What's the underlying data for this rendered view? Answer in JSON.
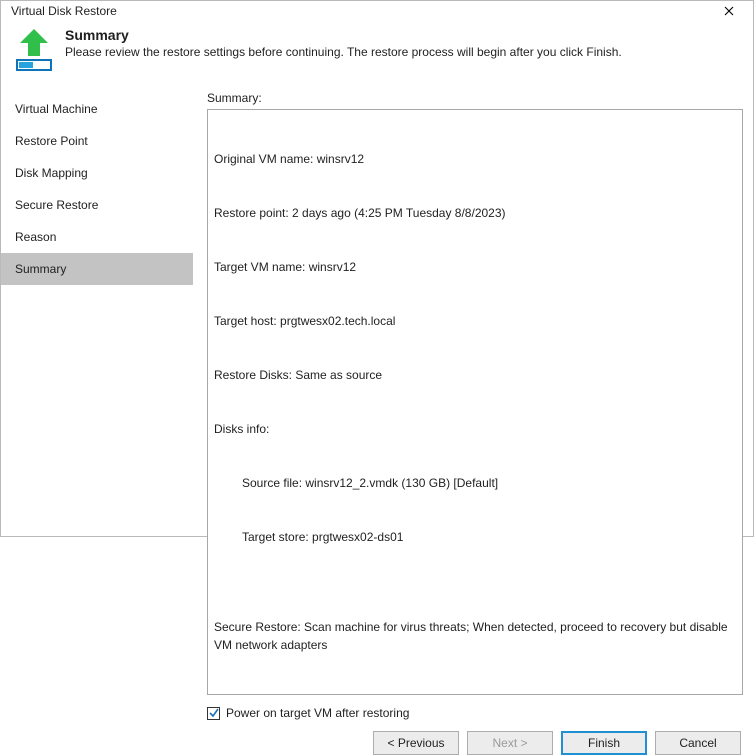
{
  "window": {
    "title": "Virtual Disk Restore"
  },
  "header": {
    "title": "Summary",
    "subtitle": "Please review the restore settings before continuing. The restore process will begin after you click Finish."
  },
  "sidebar": {
    "items": [
      {
        "label": "Virtual Machine"
      },
      {
        "label": "Restore Point"
      },
      {
        "label": "Disk Mapping"
      },
      {
        "label": "Secure Restore"
      },
      {
        "label": "Reason"
      },
      {
        "label": "Summary"
      }
    ],
    "selected_index": 5
  },
  "main": {
    "summary_label": "Summary:",
    "lines": {
      "l1": "Original VM name: winsrv12",
      "l2": "Restore point: 2 days ago (4:25 PM Tuesday 8/8/2023)",
      "l3": "Target VM name: winsrv12",
      "l4": "Target host: prgtwesx02.tech.local",
      "l5": "Restore Disks: Same as source",
      "l6": "Disks info:",
      "l7": "Source file: winsrv12_2.vmdk (130 GB) [Default]",
      "l8": "Target store: prgtwesx02-ds01",
      "l9": "",
      "l10": "Secure Restore: Scan machine for virus threats; When detected, proceed to recovery but disable VM network adapters"
    },
    "checkbox_label": "Power on target VM after restoring",
    "checkbox_checked": true
  },
  "footer": {
    "previous": "< Previous",
    "next": "Next >",
    "finish": "Finish",
    "cancel": "Cancel"
  },
  "colors": {
    "accent": "#1f91d2",
    "nav_selected": "#c3c3c3",
    "arrow": "#2fbf4a",
    "disk_border": "#0f74b7"
  }
}
